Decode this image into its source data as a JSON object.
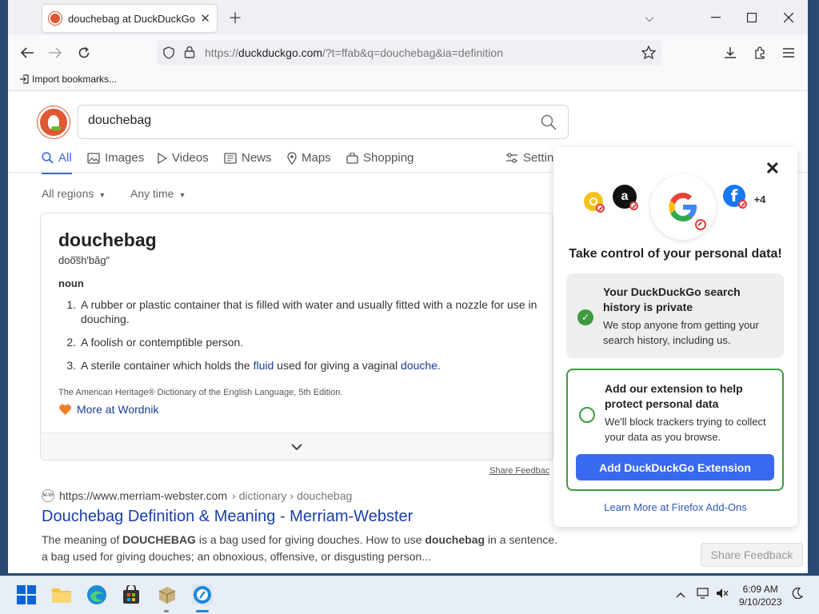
{
  "browser": {
    "tab_title": "douchebag at DuckDuckGo",
    "url_domain": "duckduckgo.com",
    "url_prefix": "https://",
    "url_suffix": "/?t=ffab&q=douchebag&ia=definition",
    "bookmark_import": "Import bookmarks..."
  },
  "search": {
    "query": "douchebag",
    "tabs": [
      {
        "label": "All",
        "icon": "search-icon"
      },
      {
        "label": "Images",
        "icon": "image-icon"
      },
      {
        "label": "Videos",
        "icon": "play-icon"
      },
      {
        "label": "News",
        "icon": "news-icon"
      },
      {
        "label": "Maps",
        "icon": "map-pin-icon"
      },
      {
        "label": "Shopping",
        "icon": "bag-icon"
      },
      {
        "label": "Settin",
        "icon": "settings-icon"
      }
    ],
    "filters": {
      "region": "All regions",
      "time": "Any time"
    }
  },
  "definition": {
    "word": "douchebag",
    "pronunciation": "doo͞sh′băg″",
    "part_of_speech": "noun",
    "senses": [
      {
        "pre": "A rubber or plastic container that is filled with water and usually fitted with a nozzle for use in douching.",
        "link1": "",
        "mid": "",
        "link2": "",
        "post": ""
      },
      {
        "pre": "A foolish or contemptible person.",
        "link1": "",
        "mid": "",
        "link2": "",
        "post": ""
      },
      {
        "pre": "A sterile container which holds the ",
        "link1": "fluid",
        "mid": " used for giving a vaginal ",
        "link2": "douche",
        "post": "."
      }
    ],
    "source": "The American Heritage® Dictionary of the English Language, 5th Edition.",
    "more_link": "More at Wordnik"
  },
  "share_feedback_inline": "Share Feedbac",
  "result": {
    "favicon_text": "M-W",
    "url": "https://www.merriam-webster.com",
    "breadcrumb": " › dictionary › douchebag",
    "title": "Douchebag Definition & Meaning - Merriam-Webster",
    "snippet_1a": "The meaning of ",
    "snippet_1b": "DOUCHEBAG",
    "snippet_1c": " is a bag used for giving douches. How to use ",
    "snippet_1d": "douchebag",
    "snippet_1e": " in a sentence.",
    "snippet_2": "a bag used for giving douches; an obnoxious, offensive, or disgusting person..."
  },
  "popup": {
    "trackers_more": "+4",
    "heading": "Take control of your personal data!",
    "step1_title": "Your DuckDuckGo search history is private",
    "step1_desc": "We stop anyone from getting your search history, including us.",
    "step2_title": "Add our extension to help protect personal data",
    "step2_desc": "We'll block trackers trying to collect your data as you browse.",
    "add_button": "Add DuckDuckGo Extension",
    "learn_more": "Learn More at Firefox Add-Ons"
  },
  "share_feedback_button": "Share Feedback",
  "taskbar": {
    "time": "6:09 AM",
    "date": "9/10/2023"
  },
  "colors": {
    "accent": "#3969ef",
    "ddg_orange": "#de5833",
    "green": "#3e9b3e",
    "link": "#1a3ea8"
  }
}
